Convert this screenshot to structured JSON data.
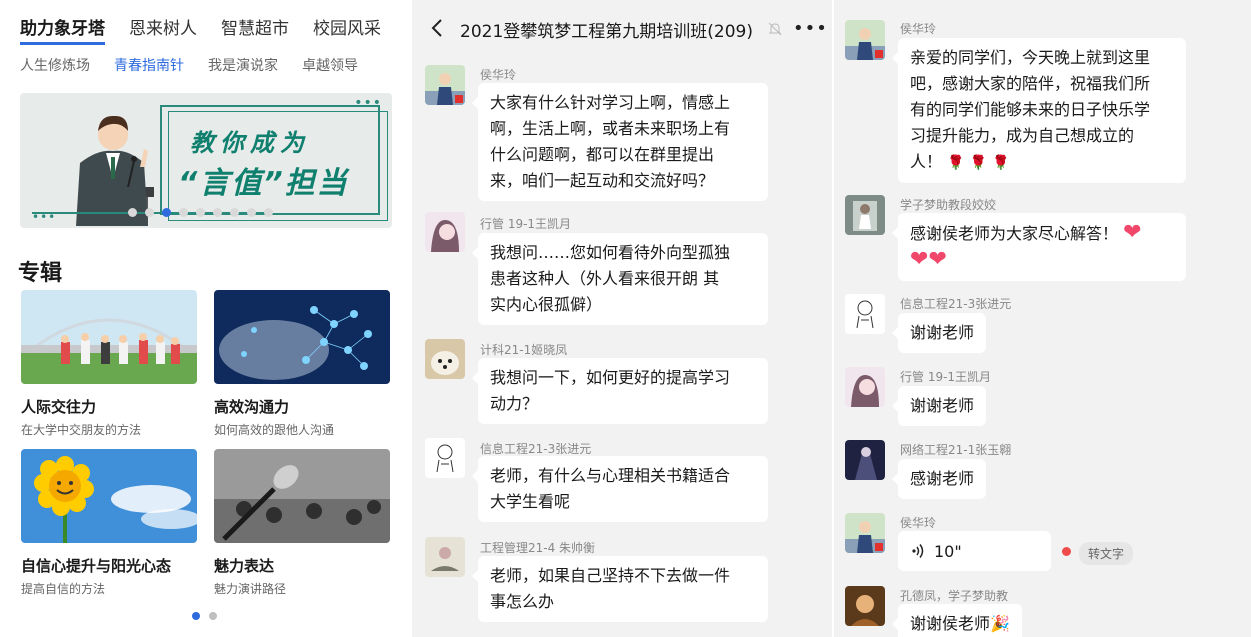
{
  "panel1": {
    "top_tabs": [
      "助力象牙塔",
      "恩来树人",
      "智慧超市",
      "校园风采"
    ],
    "sub_tabs": [
      "人生修炼场",
      "青春指南针",
      "我是演说家",
      "卓越领导"
    ],
    "banner": {
      "line1": "教你成为",
      "line2": "“言值”担当"
    },
    "section_title": "专辑",
    "cards": [
      {
        "title": "人际交往力",
        "subtitle": "在大学中交朋友的方法"
      },
      {
        "title": "高效沟通力",
        "subtitle": "如何高效的跟他人沟通"
      },
      {
        "title": "自信心提升与阳光心态",
        "subtitle": "提高自信的方法"
      },
      {
        "title": "魅力表达",
        "subtitle": "魅力演讲路径"
      }
    ]
  },
  "panel2": {
    "title": "2021登攀筑梦工程第九期培训班(209)",
    "messages": [
      {
        "sender": "侯华玲",
        "lines": [
          "大家有什么针对学习上啊，情感上",
          "啊，生活上啊，或者未来职场上有",
          "什么问题啊，都可以在群里提出",
          "来，咱们一起互动和交流好吗？"
        ]
      },
      {
        "sender": "行管 19-1王凯月",
        "lines": [
          "我想问……您如何看待外向型孤独",
          "患者这种人（外人看来很开朗 其",
          "实内心很孤僻）"
        ]
      },
      {
        "sender": "计科21-1姬晓凤",
        "lines": [
          "我想问一下，如何更好的提高学习",
          "动力？"
        ]
      },
      {
        "sender": "信息工程21-3张进元",
        "lines": [
          "老师，有什么与心理相关书籍适合",
          "大学生看呢"
        ]
      },
      {
        "sender": "工程管理21-4 朱帅衡",
        "lines": [
          "老师，如果自己坚持不下去做一件",
          "事怎么办"
        ]
      }
    ]
  },
  "panel3": {
    "messages": [
      {
        "sender": "侯华玲",
        "lines": [
          "亲爱的同学们，今天晚上就到这里",
          "吧，感谢大家的陪伴，祝福我们所",
          "有的同学们能够未来的日子快乐学",
          "习提升能力，成为自己想成立的"
        ],
        "last_line": "人！"
      },
      {
        "sender": "学子梦助教段姣姣",
        "text": "感谢侯老师为大家尽心解答！"
      },
      {
        "sender": "信息工程21-3张进元",
        "text": "谢谢老师"
      },
      {
        "sender": "行管 19-1王凯月",
        "text": "谢谢老师"
      },
      {
        "sender": "网络工程21-1张玉翱",
        "text": "感谢老师"
      },
      {
        "sender": "侯华玲",
        "voice_duration": "10\"",
        "transcribe_label": "转文字"
      },
      {
        "sender": "孔德凤，学子梦助教",
        "text": "谢谢侯老师"
      }
    ]
  },
  "colors": {
    "accent": "#2e6bde",
    "banner_green": "#0f7f6e",
    "chat_bg": "#f2f2f2",
    "heart": "#f0476a"
  },
  "icons": [
    "back-icon",
    "mute-icon",
    "more-icon",
    "voice-icon",
    "heart-icon",
    "rose-icon",
    "party-icon"
  ]
}
